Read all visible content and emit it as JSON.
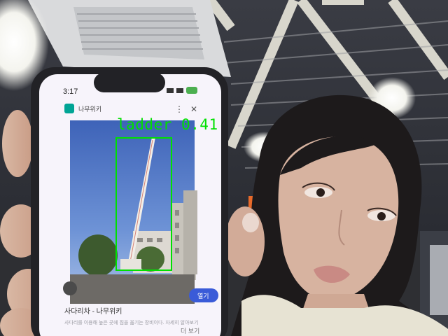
{
  "phone": {
    "status_time": "3:17",
    "tab_title": "나무위키",
    "search_snippet_title": "사다리차 - 나무위키",
    "search_snippet_text": "사다리를 이용해 높은 곳에 짐을 옮기는 장비이다. 자세히 알아보기",
    "open_button": "열기",
    "bottom_label": "더 보기"
  },
  "detection": {
    "label": "ladder",
    "confidence": "0.41",
    "color": "#00e000"
  }
}
